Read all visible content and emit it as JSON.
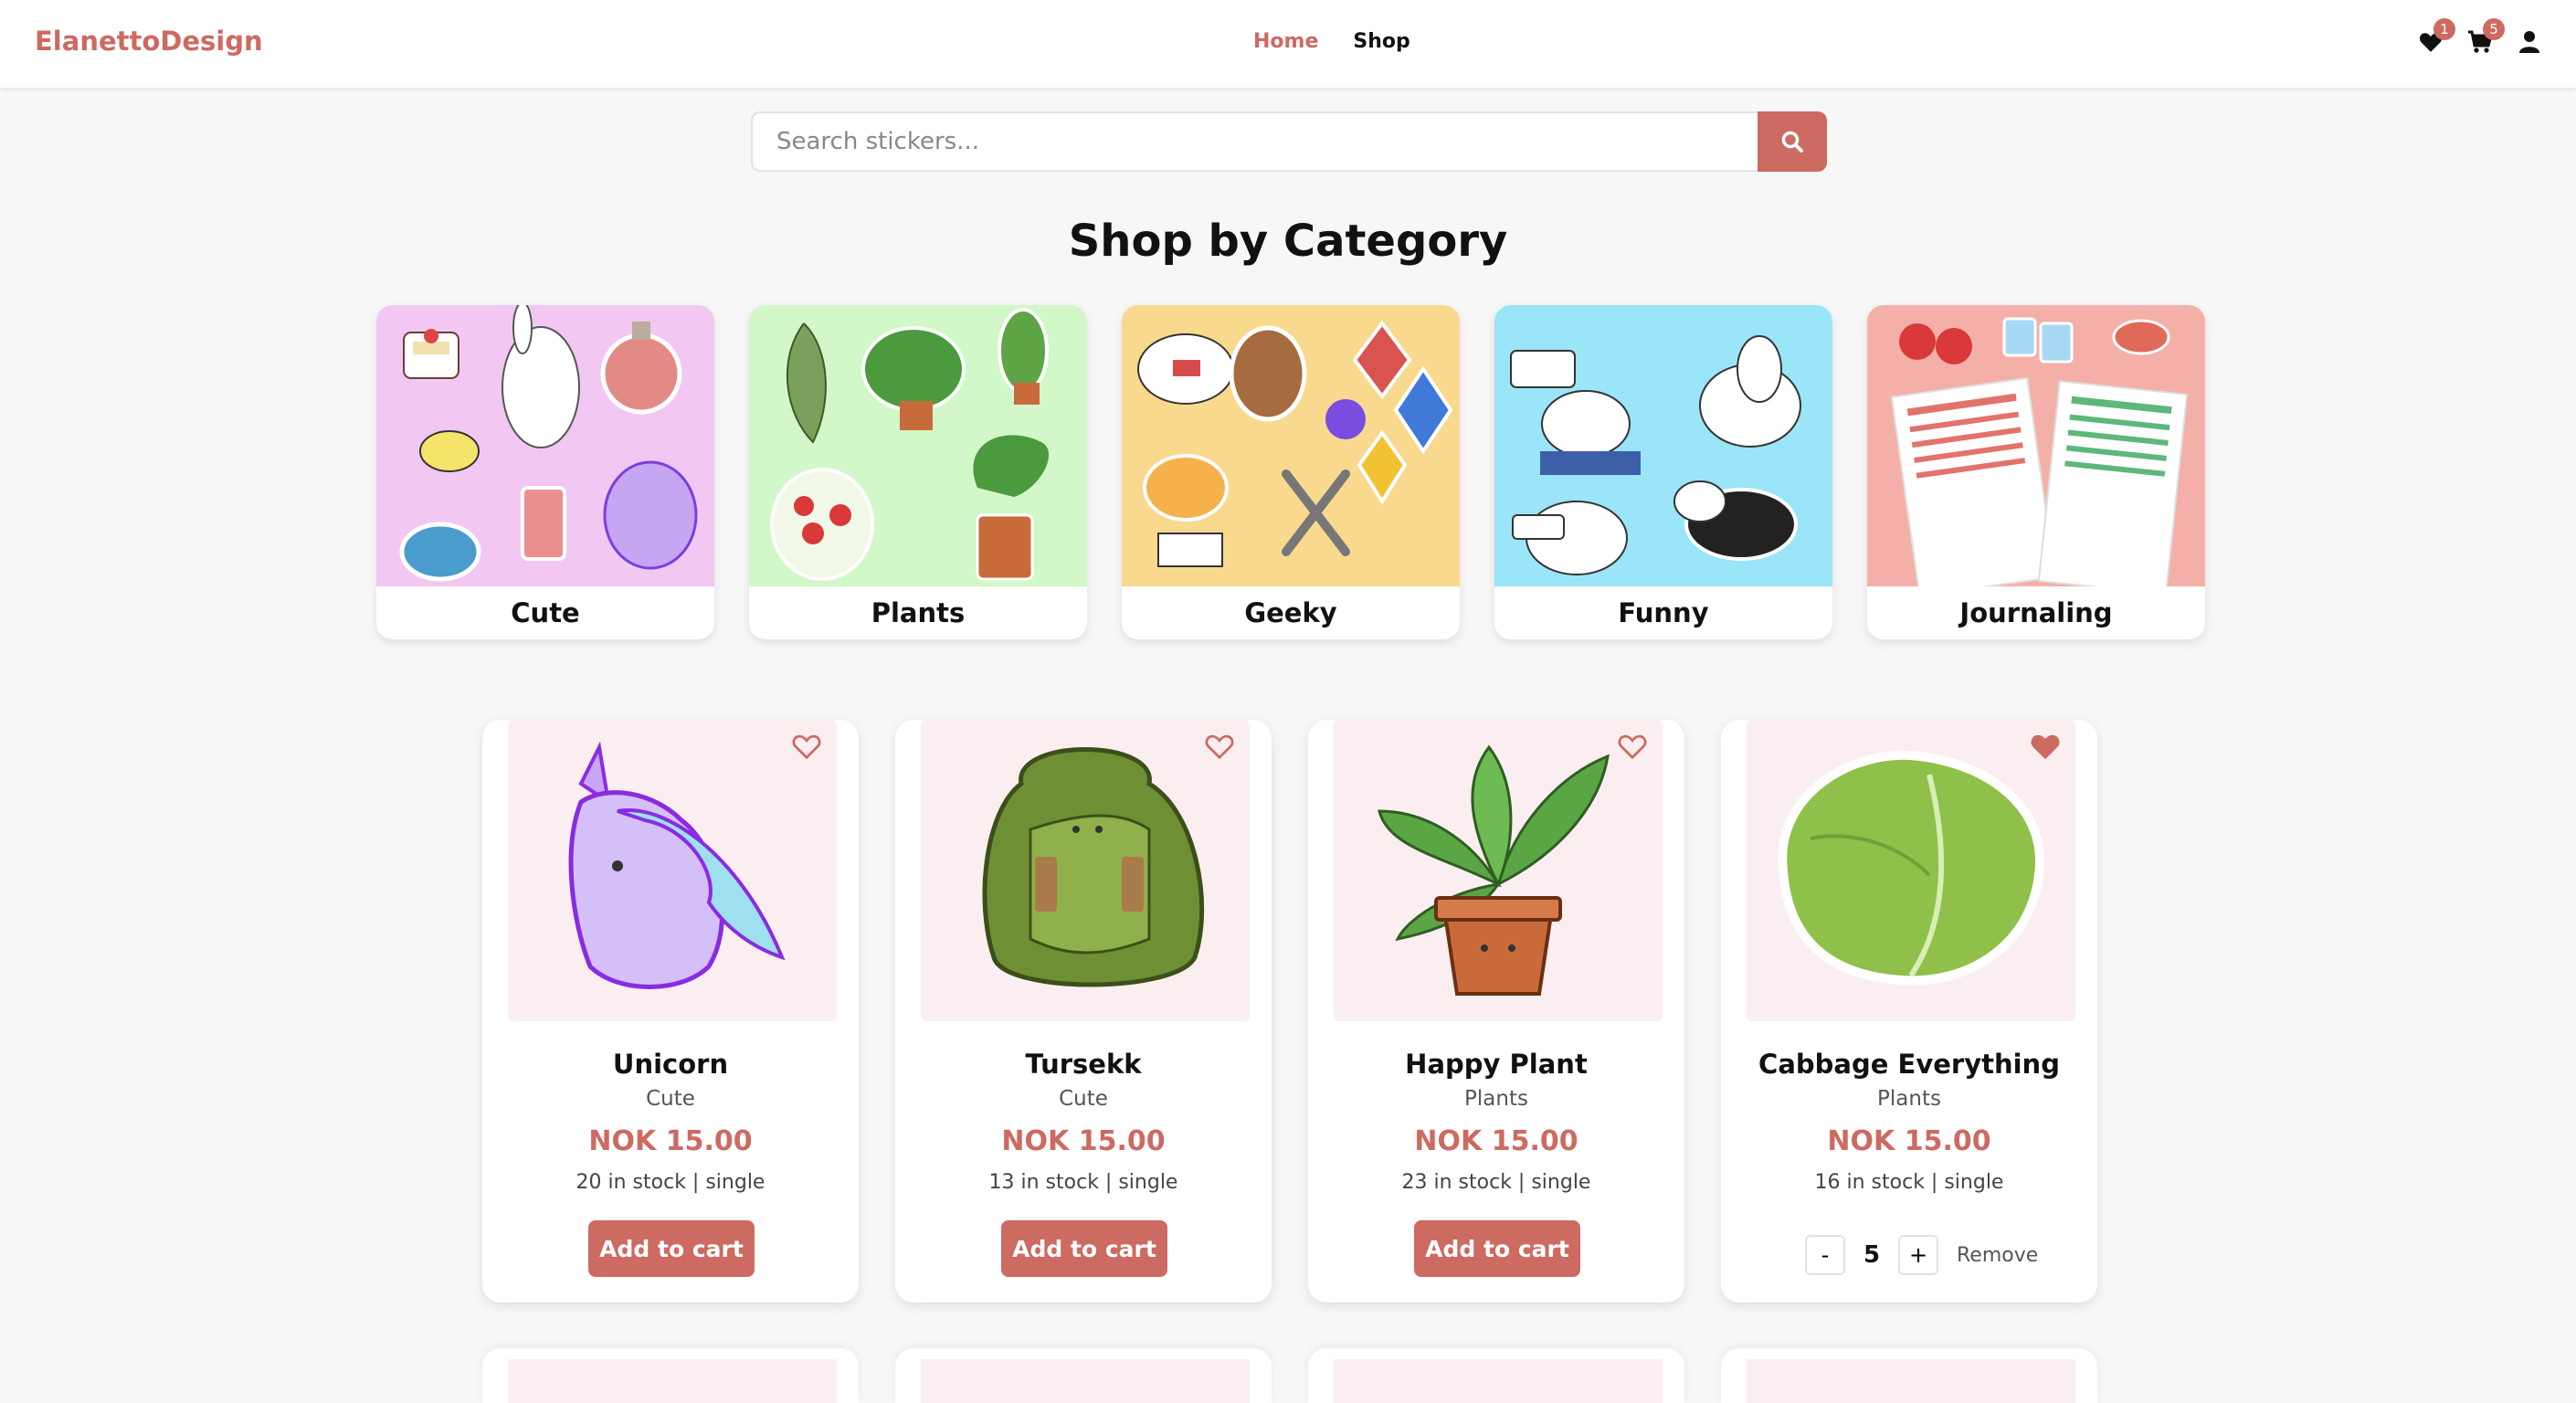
{
  "header": {
    "brand": "ElanettoDesign",
    "nav": [
      {
        "label": "Home",
        "active": true
      },
      {
        "label": "Shop",
        "active": false
      }
    ],
    "wishlist_count": "1",
    "cart_count": "5",
    "icons": [
      "heart-icon",
      "cart-icon",
      "user-icon"
    ]
  },
  "search": {
    "placeholder": "Search stickers...",
    "value": "",
    "button_icon": "search-icon"
  },
  "categories_section": {
    "title": "Shop by Category",
    "items": [
      {
        "label": "Cute",
        "bg": "#f2c8f2"
      },
      {
        "label": "Plants",
        "bg": "#d2f7c8"
      },
      {
        "label": "Geeky",
        "bg": "#f8d98e"
      },
      {
        "label": "Funny",
        "bg": "#9ae5f7"
      },
      {
        "label": "Journaling",
        "bg": "#f4b0a8"
      }
    ]
  },
  "products": [
    {
      "name": "Unicorn",
      "category": "Cute",
      "price": "NOK 15.00",
      "stock": "20 in stock | single",
      "favorite": false,
      "action": "Add to cart"
    },
    {
      "name": "Tursekk",
      "category": "Cute",
      "price": "NOK 15.00",
      "stock": "13 in stock | single",
      "favorite": false,
      "action": "Add to cart"
    },
    {
      "name": "Happy Plant",
      "category": "Plants",
      "price": "NOK 15.00",
      "stock": "23 in stock | single",
      "favorite": false,
      "action": "Add to cart"
    },
    {
      "name": "Cabbage Everything",
      "category": "Plants",
      "price": "NOK 15.00",
      "stock": "16 in stock | single",
      "favorite": true,
      "quantity": {
        "minus": "-",
        "value": "5",
        "plus": "+",
        "remove": "Remove"
      }
    }
  ],
  "colors": {
    "accent": "#cd6a61",
    "product_bg": "#fbeef0"
  }
}
